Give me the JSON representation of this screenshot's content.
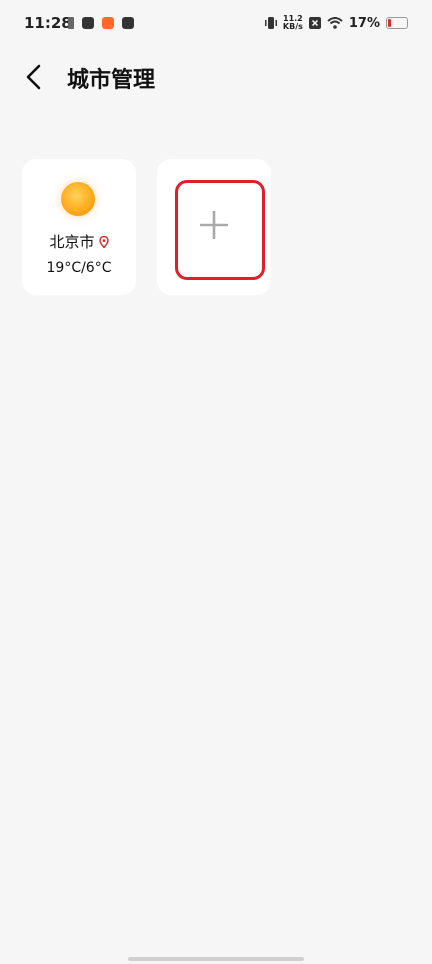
{
  "status_bar": {
    "time": "11:28",
    "net_speed_value": "11.2",
    "net_speed_unit": "KB/s",
    "battery_percent": "17%"
  },
  "header": {
    "title": "城市管理"
  },
  "cities": [
    {
      "name": "北京市",
      "temp_range": "19°C/6°C",
      "icon": "sun-icon"
    }
  ],
  "add_card": {
    "icon": "plus-icon"
  },
  "colors": {
    "background": "#f6f6f6",
    "card": "#ffffff",
    "highlight_outline": "#e41d2d",
    "location_pin": "#d12b2b",
    "sun": "#ffab1d"
  }
}
